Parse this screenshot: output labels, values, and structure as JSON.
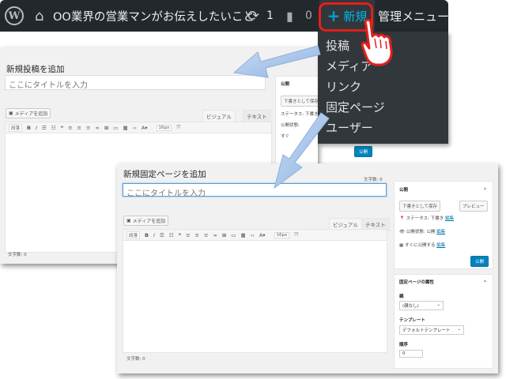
{
  "adminbar": {
    "logo": "W",
    "home_icon": "⌂",
    "site_name": "OO業界の営業マンがお伝えしたいこと",
    "updates_icon": "⟳",
    "updates_count": "1",
    "comments_icon": "▮",
    "comments_count": "0",
    "new_plus": "+",
    "new_label": "新規",
    "admin_menu": "管理メニュー"
  },
  "dropdown": {
    "items": [
      "投稿",
      "メディア",
      "リンク",
      "固定ページ",
      "ユーザー"
    ]
  },
  "post_screen": {
    "heading": "新規投稿を追加",
    "title_placeholder": "ここにタイトルを入力",
    "media_button": "メディアを追加",
    "tabs": [
      "ビジュアル",
      "テキスト"
    ],
    "format": "段落",
    "fontsize": "16px",
    "wordcount": "文字数: 0",
    "publish_title": "公開",
    "save_draft": "下書きとして保存",
    "status": "ステータス: 下書き",
    "visibility": "公開状態:",
    "schedule": "すぐ",
    "publish_button": "公開"
  },
  "page_screen": {
    "heading": "新規固定ページを追加",
    "title_placeholder": "ここにタイトルを入力",
    "wordcount_top": "文字数: 0",
    "media_button": "メディアを追加",
    "tabs": [
      "ビジュアル",
      "テキスト"
    ],
    "format": "段落",
    "fontsize": "16px",
    "wordcount": "文字数: 0",
    "publish_box": {
      "title": "公開",
      "save_draft": "下書きとして保存",
      "preview": "プレビュー",
      "status_label": "ステータス: 下書き",
      "visibility_label": "公開状態: 公開",
      "schedule_label": "すぐに公開する",
      "edit_link": "編集",
      "publish_button": "公開"
    },
    "attributes_box": {
      "title": "固定ページの属性",
      "parent_label": "親",
      "parent_value": "(親なし)",
      "template_label": "テンプレート",
      "template_value": "デフォルトテンプレート",
      "order_label": "順序",
      "order_value": "0"
    }
  },
  "colors": {
    "adminbar": "#23282d",
    "dropdown": "#32373c",
    "highlight": "#e3201b",
    "new_label": "#00b9eb",
    "arrow": "#a9c6ea",
    "publish_button": "#0085ba"
  }
}
